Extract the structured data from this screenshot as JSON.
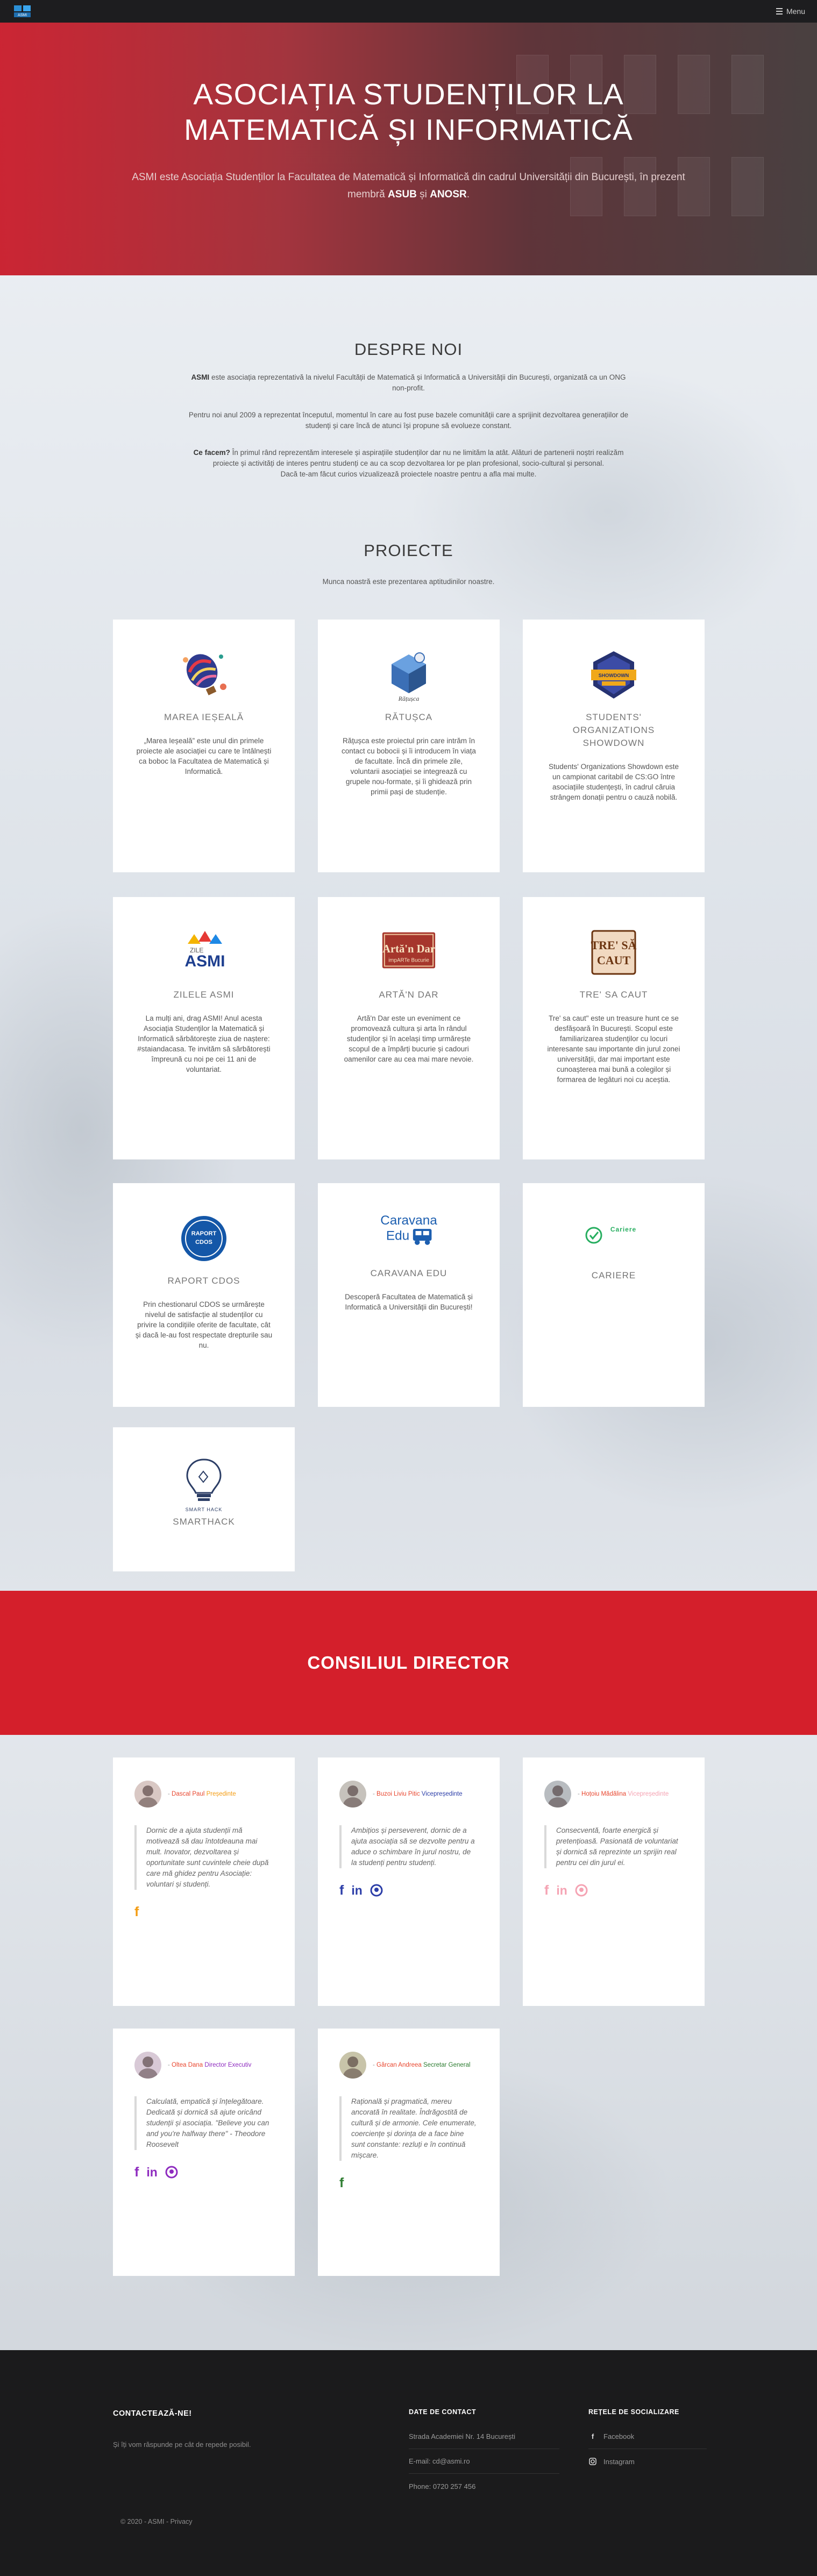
{
  "nav": {
    "menu_label": "Menu"
  },
  "hero": {
    "title_line1": "ASOCIAȚIA STUDENȚILOR LA",
    "title_line2": "MATEMATICĂ ȘI INFORMATICĂ",
    "subtitle_pre": "ASMI este Asociația Studenților la Facultatea de Matematică și Informatică din cadrul Universității din București, în prezent membră ",
    "subtitle_asub": "ASUB",
    "subtitle_and": " și ",
    "subtitle_anosr": "ANOSR",
    "subtitle_end": "."
  },
  "about": {
    "title": "DESPRE NOI",
    "p1_bold": "ASMI",
    "p1_rest": " este asociația reprezentativă la nivelul Facultății de Matematică și Informatică a Universității din București, organizată ca un ONG non-profit.",
    "p2": "Pentru noi anul 2009 a reprezentat începutul, momentul în care au fost puse bazele comunității care a sprijinit dezvoltarea generațiilor de studenți și care încă de atunci își propune să evolueze constant.",
    "p3_bold": "Ce facem?",
    "p3_rest": " În primul rând reprezentăm interesele și aspirațiile studenților dar nu ne limităm la atât. Alături de partenerii noștri realizăm proiecte și activități de interes pentru studenți ce au ca scop dezvoltarea lor pe plan profesional, socio-cultural și personal.",
    "p4": "Dacă te-am făcut curios vizualizează proiectele noastre pentru a afla mai multe."
  },
  "projects": {
    "title": "PROIECTE",
    "subtitle": "Munca noastră este prezentarea aptitudinilor noastre.",
    "items": [
      {
        "name": "MAREA IEȘEALĂ",
        "icon": "balloon-icon",
        "desc": "„Marea Ieșeală” este unul din primele proiecte ale asociației cu care te întâlnești ca boboc la Facultatea de Matematică și Informatică."
      },
      {
        "name": "RĂTUȘCA",
        "icon": "duck-icon",
        "desc": "Rățușca este proiectul prin care intrăm în contact cu bobocii și îi introducem în viața de facultate. Încă din primele zile, voluntarii asociației se integrează cu grupele nou-formate, și îi ghidează prin primii pași de studenție."
      },
      {
        "name": "STUDENTS' ORGANIZATIONS SHOWDOWN",
        "icon": "shield-icon",
        "desc": "Students' Organizations Showdown este un campionat caritabil de CS:GO între asociațiile studențești, în cadrul căruia strângem donații pentru o cauză nobilă."
      },
      {
        "name": "ZILELE ASMI",
        "icon": "asmi-logo-icon",
        "desc": "La mulți ani, drag ASMI! Anul acesta Asociația Studenților la Matematică și Informatică sărbătorește ziua de naștere: #staiandacasa. Te invităm să sărbătorești împreună cu noi pe cei 11 ani de voluntariat."
      },
      {
        "name": "ARTĂ'N DAR",
        "icon": "art-sign-icon",
        "desc": "Artă'n Dar este un eveniment ce promovează cultura și arta în rândul studenților și în același timp urmărește scopul de a împărți bucurie și cadouri oamenilor care au cea mai mare nevoie."
      },
      {
        "name": "TRE' SA CAUT",
        "icon": "treasure-icon",
        "desc": "Tre' sa caut\" este un treasure hunt ce se desfășoară în București. Scopul este familiarizarea studenților cu locuri interesante sau importante din jurul zonei universității, dar mai important este cunoașterea mai bună a colegilor și formarea de legături noi cu aceștia."
      },
      {
        "name": "RAPORT CDOS",
        "icon": "report-badge-icon",
        "desc": "Prin chestionarul CDOS se urmărește nivelul de satisfacție al studenților cu privire la condițiile oferite de facultate, cât și dacă le-au fost respectate drepturile sau nu."
      },
      {
        "name": "CARAVANA EDU",
        "icon": "van-icon",
        "desc": "Descoperă Facultatea de Matematică și Informatică a Universității din București!"
      },
      {
        "name": "CARIERE",
        "icon": "check-circle-icon",
        "logo_text": "Cariere",
        "desc": ""
      },
      {
        "name": "SMARTHACK",
        "icon": "lightbulb-icon",
        "logo_text": "SMART HACK",
        "desc": ""
      }
    ]
  },
  "council": {
    "title": "CONSILIUL DIRECTOR",
    "members": [
      {
        "name": "Dascal Paul",
        "role": "Președinte",
        "color": "#f39c12",
        "quote": "Dornic de a ajuta studenții mă motivează să dau întotdeauna mai mult. Inovator, dezvoltarea și oportunitate sunt cuvintele cheie după care mă ghidez pentru Asociație: voluntari și studenți.",
        "socials": [
          "facebook"
        ]
      },
      {
        "name": "Buzoi Liviu Pitic",
        "role": "Vicepreședinte",
        "color": "#2c3ea8",
        "quote": "Ambițios și perseverent, dornic de a ajuta asociația să se dezvolte pentru a aduce o schimbare în jurul nostru, de la studenți pentru studenți.",
        "socials": [
          "facebook",
          "linkedin",
          "github"
        ]
      },
      {
        "name": "Hoțoiu Mădălina",
        "role": "Vicepreședinte",
        "color": "#f5a3b3",
        "quote": "Consecventă, foarte energică și pretențioasă. Pasionată de voluntariat și dornică să reprezinte un sprijin real pentru cei din jurul ei.",
        "socials": [
          "facebook",
          "linkedin",
          "github"
        ]
      },
      {
        "name": "Oltea Dana",
        "role": "Director Executiv",
        "color": "#8e2bbf",
        "quote": "Calculată, empatică și înțelegătoare. Dedicată și dornică să ajute oricând studenții și asociația. \"Believe you can and you're halfway there\" - Theodore Roosevelt",
        "socials": [
          "facebook",
          "linkedin",
          "github"
        ]
      },
      {
        "name": "Gârcan Andreea",
        "role": "Secretar General",
        "color": "#2e7d32",
        "quote": "Rațională și pragmatică, mereu ancorată în realitate. Îndrăgostită de cultură și de armonie. Cele enumerate, coerciențe și dorința de a face bine sunt constante: rezluți e în continuă mișcare.",
        "socials": [
          "facebook"
        ]
      }
    ]
  },
  "footer": {
    "contact_title": "CONTACTEAZĂ-NE!",
    "contact_text": "Și îți vom răspunde pe cât de repede posibil.",
    "info_title": "DATE DE CONTACT",
    "address": "Strada Academiei Nr. 14 București",
    "email": "E-mail: cd@asmi.ro",
    "phone": "Phone: 0720 257 456",
    "social_title": "REȚELE DE SOCIALIZARE",
    "facebook": "Facebook",
    "instagram": "Instagram",
    "copyright": "© 2020 - ASMI - Privacy"
  },
  "colors": {
    "brand_red": "#d41f2b",
    "dark": "#1b1b1c"
  }
}
